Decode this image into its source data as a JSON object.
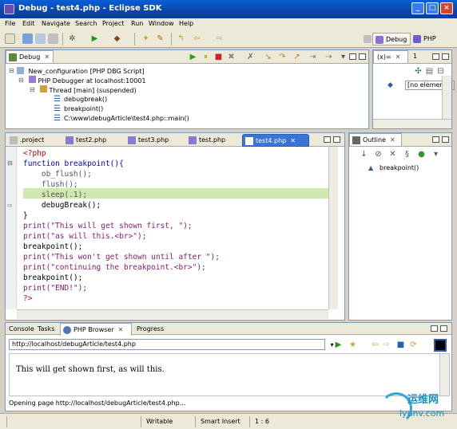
{
  "window": {
    "title": "Debug - test4.php - Eclipse SDK"
  },
  "menu": [
    "File",
    "Edit",
    "Navigate",
    "Search",
    "Project",
    "Run",
    "Window",
    "Help"
  ],
  "perspectives": {
    "debug": "Debug",
    "php": "PHP"
  },
  "debug_view": {
    "tab_label": "Debug",
    "tree": [
      {
        "label": "New_configuration [PHP DBG Script]",
        "level": 0
      },
      {
        "label": "PHP Debugger at localhost:10001",
        "level": 1
      },
      {
        "label": "Thread [main] (suspended)",
        "level": 2
      },
      {
        "label": "debugbreak()",
        "level": 3
      },
      {
        "label": "breakpoint()",
        "level": 3
      },
      {
        "label": "C:\\www\\debugArticle\\test4.php::main()",
        "level": 3
      }
    ]
  },
  "variables_view": {
    "tab_label": "(x)=",
    "second_tab": "1",
    "no_elements": "[no elements]"
  },
  "editor": {
    "tabs": [
      ".project",
      "test2.php",
      "test3.php",
      "test.php",
      "test4.php"
    ],
    "active_tab": "test4.php",
    "lines": [
      "<?php",
      "function breakpoint(){",
      "    ob_flush();",
      "    flush();",
      "    sleep(.1);",
      "    debugBreak();",
      "}",
      "print(\"This will get shown first, \");",
      "print(\"as will this.<br>\");",
      "breakpoint();",
      "print(\"This won't get shown until after \");",
      "print(\"continuing the breakpoint.<br>\");",
      "breakpoint();",
      "print(\"END!\");",
      "?>"
    ]
  },
  "outline": {
    "tab_label": "Outline",
    "item": "breakpoint()"
  },
  "bottom": {
    "tabs": [
      "Console",
      "Tasks",
      "PHP Browser",
      "Progress"
    ],
    "url": "http://localhost/debugArticle/test4.php",
    "content": "This will get shown first, as will this.",
    "status": "Opening page http://localhost/debugArticle/test4.php..."
  },
  "statusbar": {
    "mode": "Writable",
    "insert": "Smart Insert",
    "position": "1 : 6"
  },
  "watermark": {
    "cn": "运维网",
    "url": "iyunv.com"
  },
  "colors": {
    "title_bar": "#0846ac",
    "active_tab": "#3875d7",
    "highlight_line": "#cfe8b0"
  }
}
